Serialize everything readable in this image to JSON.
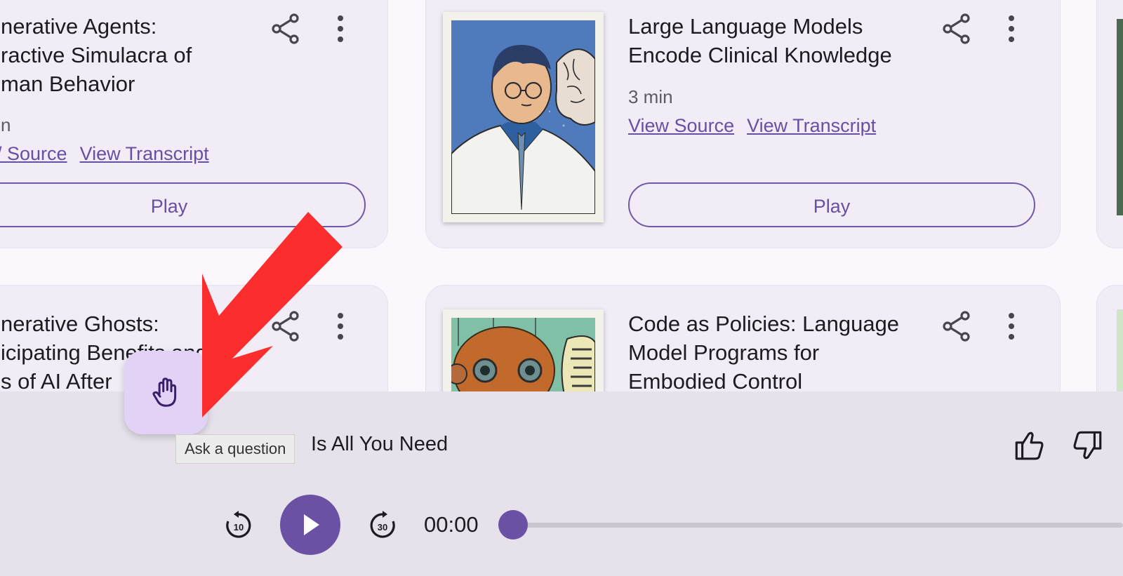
{
  "cards": [
    {
      "title_lines": [
        "nerative Agents:",
        "ractive Simulacra of",
        "man Behavior"
      ],
      "duration": "n",
      "view_source": "/ Source",
      "view_transcript": "View Transcript",
      "play": "Play"
    },
    {
      "title_lines": [
        "Large Language Models",
        "Encode Clinical Knowledge"
      ],
      "duration": "3 min",
      "view_source": "View Source",
      "view_transcript": "View Transcript",
      "play": "Play"
    },
    {
      "title_lines": [
        "nerative Ghosts:",
        "icipating Benefits and",
        "s of AI After"
      ]
    },
    {
      "title_lines": [
        "Code as Policies: Language",
        "Model Programs for",
        "Embodied Control"
      ]
    }
  ],
  "player": {
    "ask_tooltip": "Ask a question",
    "now_playing": "Is All You Need",
    "time": "00:00",
    "progress": 0,
    "rewind_label": "10",
    "forward_label": "30"
  },
  "colors": {
    "accent": "#6a51a4",
    "annotation_arrow": "#fb2d2d"
  }
}
